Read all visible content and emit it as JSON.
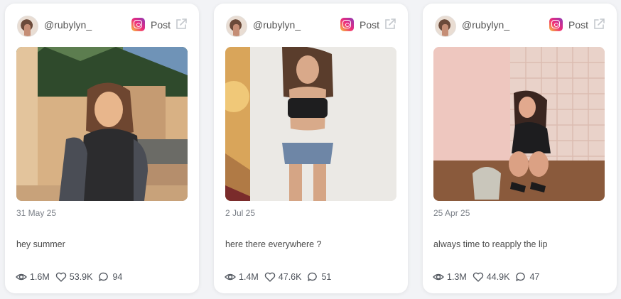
{
  "posts": [
    {
      "handle": "@rubylyn_",
      "post_label": "Post",
      "date": "31 May 25",
      "caption": "hey summer",
      "views": "1.6M",
      "likes": "53.9K",
      "comments": "94"
    },
    {
      "handle": "@rubylyn_",
      "post_label": "Post",
      "date": "2 Jul 25",
      "caption": "here there everywhere ?",
      "views": "1.4M",
      "likes": "47.6K",
      "comments": "51"
    },
    {
      "handle": "@rubylyn_",
      "post_label": "Post",
      "date": "25 Apr 25",
      "caption": "always time to reapply the lip",
      "views": "1.3M",
      "likes": "44.9K",
      "comments": "47"
    }
  ],
  "icons": {
    "platform": "instagram-icon",
    "external": "external-link-icon",
    "views": "eye-icon",
    "likes": "heart-icon",
    "comments": "comment-icon"
  },
  "colors": {
    "background": "#f2f3f6",
    "card": "#ffffff",
    "text_muted": "#7a7f87"
  }
}
